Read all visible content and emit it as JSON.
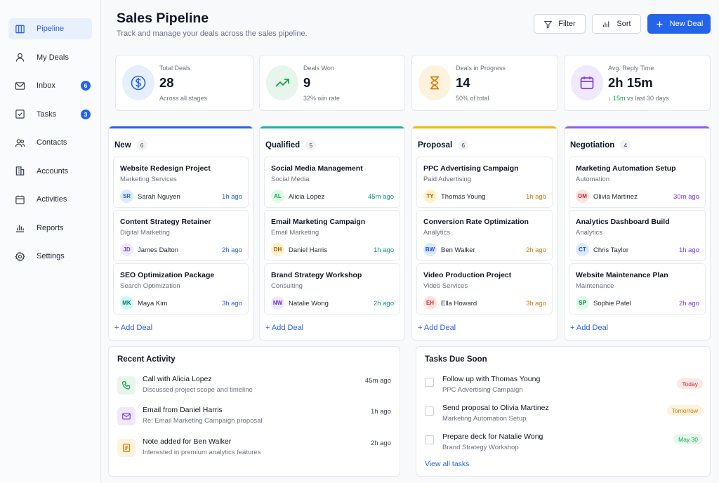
{
  "sidebar": {
    "items": [
      {
        "label": "Pipeline",
        "icon": "columns-icon",
        "active": true
      },
      {
        "label": "My Deals",
        "icon": "user-icon"
      },
      {
        "label": "Inbox",
        "icon": "mail-icon",
        "badge": "6"
      },
      {
        "label": "Tasks",
        "icon": "checkbox-icon",
        "badge": "3"
      },
      {
        "label": "Contacts",
        "icon": "users-icon"
      },
      {
        "label": "Accounts",
        "icon": "building-icon"
      },
      {
        "label": "Activities",
        "icon": "calendar-icon"
      },
      {
        "label": "Reports",
        "icon": "bar-chart-icon"
      },
      {
        "label": "Settings",
        "icon": "gear-icon"
      }
    ]
  },
  "header": {
    "title": "Sales Pipeline",
    "subtitle": "Track and manage your deals across the sales pipeline.",
    "filter_label": "Filter",
    "sort_label": "Sort",
    "new_deal_label": "New Deal"
  },
  "stats": [
    {
      "label": "Total Deals",
      "value": "28",
      "sub": "Across all stages",
      "icon": "dollar-circle-icon",
      "color": "#2563eb",
      "bg": "#e6effd"
    },
    {
      "label": "Deals Won",
      "value": "9",
      "sub": "32% win rate",
      "icon": "trending-up-icon",
      "color": "#16a34a",
      "bg": "#e6f6ec"
    },
    {
      "label": "Deals in Progress",
      "value": "14",
      "sub": "50% of total",
      "icon": "hourglass-icon",
      "color": "#d97706",
      "bg": "#fdf3dc"
    },
    {
      "label": "Avg. Reply Time",
      "value": "2h 15m",
      "sub_arrow": "↓",
      "sub_highlight": "15m",
      "sub_rest": "vs last 30 days",
      "icon": "calendar-icon",
      "color": "#7c3aed",
      "bg": "#f0e9fd"
    }
  ],
  "colors": {
    "accent": "#2563eb",
    "new": "#2563eb",
    "qualified": "#14b8a6",
    "proposal": "#f5b800",
    "negotiation": "#8b5cf6"
  },
  "columns": [
    {
      "name": "New",
      "count": "6",
      "add_label": "+ Add Deal",
      "deals": [
        {
          "title": "Website Redesign Project",
          "category": "Marketing Services",
          "initials": "SR",
          "owner": "Sarah Nguyen",
          "time": "1h ago"
        },
        {
          "title": "Content Strategy Retainer",
          "category": "Digital Marketing",
          "initials": "JD",
          "owner": "James Dalton",
          "time": "2h ago"
        },
        {
          "title": "SEO Optimization Package",
          "category": "Search Optimization",
          "initials": "MK",
          "owner": "Maya Kim",
          "time": "3h ago"
        }
      ]
    },
    {
      "name": "Qualified",
      "count": "5",
      "add_label": "+ Add Deal",
      "deals": [
        {
          "title": "Social Media Management",
          "category": "Social Media",
          "initials": "AL",
          "owner": "Alicia Lopez",
          "time": "45m ago"
        },
        {
          "title": "Email Marketing Campaign",
          "category": "Email Marketing",
          "initials": "DH",
          "owner": "Daniel Harris",
          "time": "1h ago"
        },
        {
          "title": "Brand Strategy Workshop",
          "category": "Consulting",
          "initials": "NW",
          "owner": "Natalie Wong",
          "time": "2h ago"
        }
      ]
    },
    {
      "name": "Proposal",
      "count": "6",
      "add_label": "+ Add Deal",
      "deals": [
        {
          "title": "PPC Advertising Campaign",
          "category": "Paid Advertising",
          "initials": "TY",
          "owner": "Thomas Young",
          "time": "1h ago"
        },
        {
          "title": "Conversion Rate Optimization",
          "category": "Analytics",
          "initials": "BW",
          "owner": "Ben Walker",
          "time": "2h ago"
        },
        {
          "title": "Video Production Project",
          "category": "Video Services",
          "initials": "EH",
          "owner": "Ella Howard",
          "time": "3h ago"
        }
      ]
    },
    {
      "name": "Negotiation",
      "count": "4",
      "add_label": "+ Add Deal",
      "deals": [
        {
          "title": "Marketing Automation Setup",
          "category": "Automation",
          "initials": "OM",
          "owner": "Olivia Martinez",
          "time": "30m ago"
        },
        {
          "title": "Analytics Dashboard Build",
          "category": "Analytics",
          "initials": "CT",
          "owner": "Chris Taylor",
          "time": "1h ago"
        },
        {
          "title": "Website Maintenance Plan",
          "category": "Maintenance",
          "initials": "SP",
          "owner": "Sophie Patel",
          "time": "2h ago"
        }
      ]
    }
  ],
  "recent_activity": {
    "title": "Recent Activity",
    "items": [
      {
        "title": "Call with Alicia Lopez",
        "desc": "Discussed project scope and timeline",
        "time": "45m ago",
        "icon": "phone-icon"
      },
      {
        "title": "Email from Daniel Harris",
        "desc": "Re: Email Marketing Campaign proposal",
        "time": "1h ago",
        "icon": "mail-icon"
      },
      {
        "title": "Note added for Ben Walker",
        "desc": "Interested in premium analytics features",
        "time": "2h ago",
        "icon": "note-icon"
      }
    ]
  },
  "tasks_due": {
    "title": "Tasks Due Soon",
    "view_all": "View all tasks",
    "items": [
      {
        "title": "Follow up with Thomas Young",
        "desc": "PPC Advertising Campaign",
        "badge": "Today"
      },
      {
        "title": "Send proposal to Olivia Martinez",
        "desc": "Marketing Automation Setup",
        "badge": "Tomorrow"
      },
      {
        "title": "Prepare deck for Natalie Wong",
        "desc": "Brand Strategy Workshop",
        "badge": "May 30"
      }
    ]
  }
}
